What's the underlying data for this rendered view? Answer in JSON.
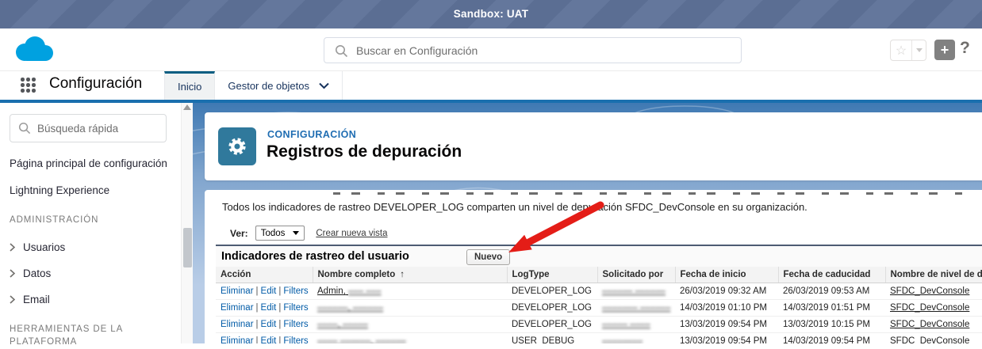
{
  "banner": {
    "text": "Sandbox: UAT"
  },
  "topbar": {
    "search": {
      "placeholder": "Buscar en Configuración"
    },
    "add_label": "+",
    "help_label": "?"
  },
  "nav": {
    "app_title": "Configuración",
    "tabs": [
      {
        "label": "Inicio"
      },
      {
        "label": "Gestor de objetos"
      }
    ]
  },
  "sidebar": {
    "search_placeholder": "Búsqueda rápida",
    "links": [
      "Página principal de configuración",
      "Lightning Experience"
    ],
    "section1": {
      "title": "ADMINISTRACIÓN",
      "items": [
        "Usuarios",
        "Datos",
        "Email"
      ]
    },
    "section2": {
      "title": "HERRAMIENTAS DE LA PLATAFORMA"
    }
  },
  "main": {
    "eyebrow": "CONFIGURACIÓN",
    "title": "Registros de depuración",
    "description": "Todos los indicadores de rastreo DEVELOPER_LOG comparten un nivel de depuración SFDC_DevConsole en su organización.",
    "view_bar": {
      "label": "Ver:",
      "selected_option": "Todos",
      "create_link": "Crear nueva vista"
    },
    "list": {
      "title": "Indicadores de rastreo del usuario",
      "new_button": "Nuevo",
      "columns": [
        "Acción",
        "Nombre completo",
        "LogType",
        "Solicitado por",
        "Fecha de inicio",
        "Fecha de caducidad",
        "Nombre de nivel de de"
      ],
      "sort_indicator": "↑",
      "action_links": [
        "Eliminar",
        "Edit",
        "Filters"
      ],
      "action_separator": "|",
      "rows": [
        {
          "name_visible": "Admin,",
          "name_redacted": "––– –––",
          "logtype": "DEVELOPER_LOG",
          "requested_by": "–––––– ––––––",
          "start": "26/03/2019 09:32 AM",
          "expiry": "26/03/2019 09:53 AM",
          "level": "SFDC_DevConsole"
        },
        {
          "name_visible": "",
          "name_redacted": "––––––, ––––––",
          "logtype": "DEVELOPER_LOG",
          "requested_by": "––––––– ––––––",
          "start": "14/03/2019 01:10 PM",
          "expiry": "14/03/2019 01:51 PM",
          "level": "SFDC_DevConsole"
        },
        {
          "name_visible": "",
          "name_redacted": "––––, –––––",
          "logtype": "DEVELOPER_LOG",
          "requested_by": "––––– ––––",
          "start": "13/03/2019 09:54 PM",
          "expiry": "13/03/2019 10:15 PM",
          "level": "SFDC_DevConsole"
        },
        {
          "name_visible": "",
          "name_redacted": "–––– ––––––, ––––––",
          "logtype": "USER_DEBUG",
          "requested_by": "––––––––",
          "start": "13/03/2019 09:54 PM",
          "expiry": "14/03/2019 09:54 PM",
          "level": "SFDC_DevConsole"
        }
      ]
    }
  },
  "colors": {
    "brand_blue": "#1a6fae",
    "banner_bg": "#5b6e93",
    "gear_tile": "#30799c",
    "link_blue": "#015ba7",
    "arrow_red": "#e41d17"
  }
}
